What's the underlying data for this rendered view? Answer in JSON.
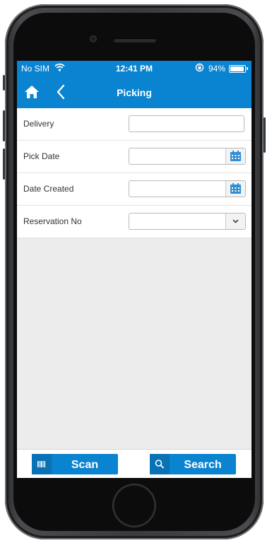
{
  "status_bar": {
    "carrier": "No SIM",
    "time": "12:41 PM",
    "battery": "94%",
    "battery_level": 0.94
  },
  "header": {
    "title": "Picking",
    "home_icon": "home-icon",
    "back_icon": "chevron-left-icon"
  },
  "form": {
    "fields": [
      {
        "label": "Delivery",
        "value": "",
        "type": "text"
      },
      {
        "label": "Pick Date",
        "value": "",
        "type": "date"
      },
      {
        "label": "Date Created",
        "value": "",
        "type": "date"
      },
      {
        "label": "Reservation No",
        "value": "",
        "type": "select"
      }
    ]
  },
  "footer": {
    "scan_label": "Scan",
    "search_label": "Search",
    "scan_icon": "barcode-icon",
    "search_icon": "search-icon"
  },
  "colors": {
    "accent": "#0a84d1",
    "accent_dark": "#0872b4",
    "background": "#ececec",
    "calendar": "#2f8fd6"
  }
}
